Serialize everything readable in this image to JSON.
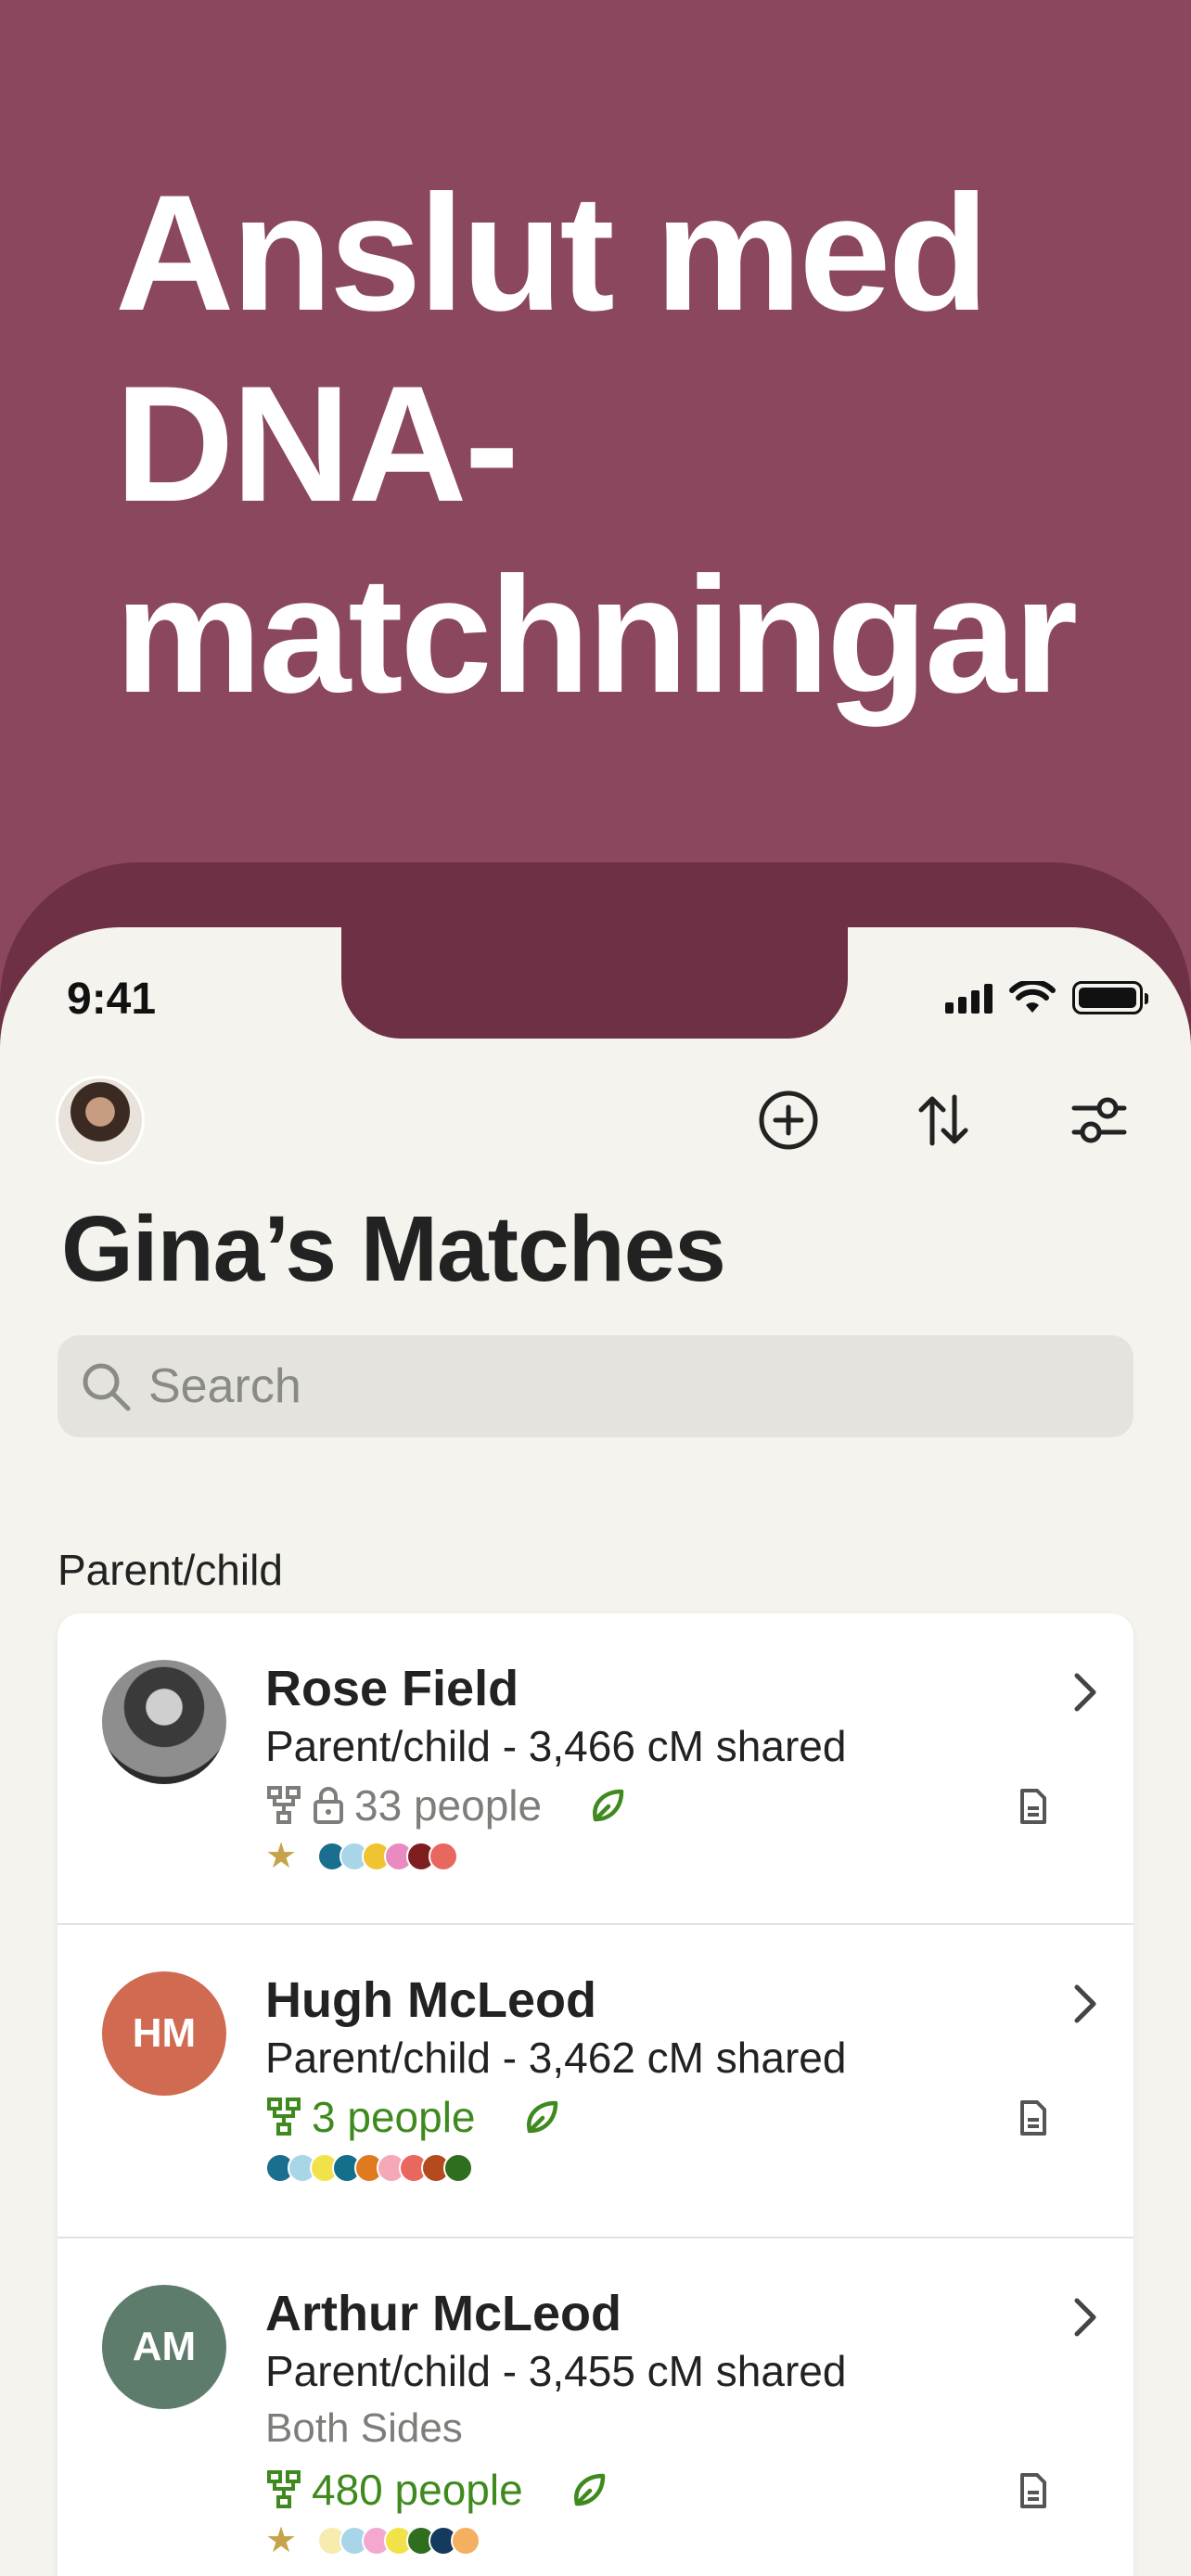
{
  "promo": {
    "headline_lines": [
      "Anslut med",
      "DNA-",
      "matchningar"
    ]
  },
  "status_bar": {
    "time": "9:41"
  },
  "header": {
    "title": "Gina’s Matches",
    "search_placeholder": "Search"
  },
  "section": {
    "label": "Parent/child"
  },
  "matches": [
    {
      "name": "Rose Field",
      "relationship": "Parent/child - 3,466 cM shared",
      "side": "",
      "people": "33 people",
      "people_locked": true,
      "starred": true,
      "avatar_initials": "",
      "avatar_color": "#555555",
      "dots": [
        "#1a6f8f",
        "#a8d6e8",
        "#f0c330",
        "#e98ac0",
        "#7e1e1e",
        "#e8675e"
      ]
    },
    {
      "name": "Hugh McLeod",
      "relationship": "Parent/child - 3,462 cM shared",
      "side": "",
      "people": "3 people",
      "people_locked": false,
      "starred": false,
      "avatar_initials": "HM",
      "avatar_color": "#d06b52",
      "dots": [
        "#1a6f8f",
        "#a8d6e8",
        "#f2e24a",
        "#136f8a",
        "#e07a1f",
        "#f4a8b8",
        "#e8675e",
        "#b44a1e",
        "#2f6e1e"
      ]
    },
    {
      "name": "Arthur McLeod",
      "relationship": "Parent/child - 3,455 cM shared",
      "side": "Both Sides",
      "people": "480 people",
      "people_locked": false,
      "starred": true,
      "avatar_initials": "AM",
      "avatar_color": "#5e7c6c",
      "dots": [
        "#f6ecb0",
        "#a8d6e8",
        "#f4a8d0",
        "#f2e24a",
        "#2f6e1e",
        "#143a5e",
        "#f4b060"
      ]
    }
  ]
}
